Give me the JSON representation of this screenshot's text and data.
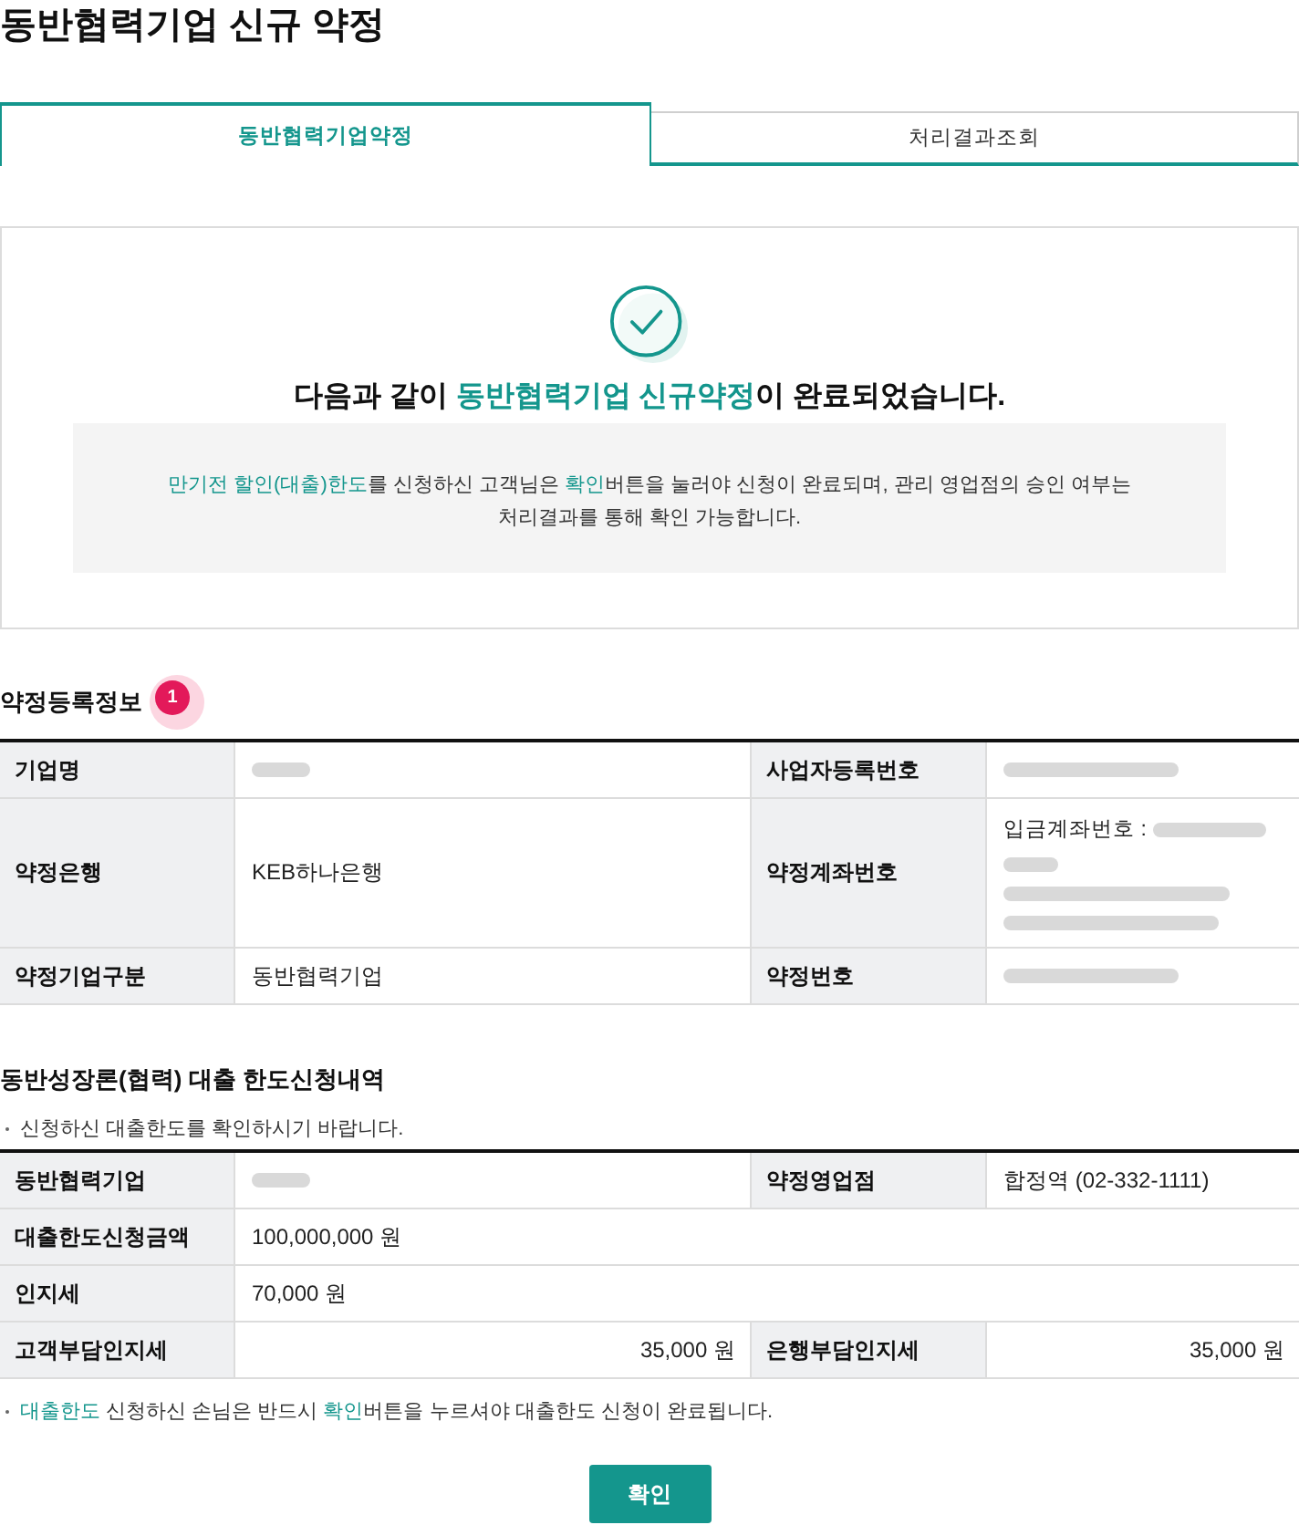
{
  "page": {
    "title": "동반협력기업 신규 약정"
  },
  "tabs": [
    {
      "label": "동반협력기업약정",
      "selected": true
    },
    {
      "label": "처리결과조회",
      "selected": false
    }
  ],
  "result": {
    "headline": "다음과 같이 **동반협력기업 신규약정**이 완료되었습니다.",
    "note": "**만기전 할인(대출)한도**를 신청하신 고객님은 **확인**버튼을 눌러야 신청이 완료되며, 관리 영업점의 승인 여부는 처리결과를 통해 확인 가능합니다."
  },
  "agreement": {
    "title": "약정등록정보",
    "badge": "1",
    "rows": [
      {
        "cells": [
          {
            "kind": "label",
            "text": "기업명"
          },
          {
            "kind": "redacted"
          },
          {
            "kind": "label",
            "text": "사업자등록번호"
          },
          {
            "kind": "redacted"
          }
        ]
      },
      {
        "cells": [
          {
            "kind": "label",
            "text": "약정은행"
          },
          {
            "kind": "value",
            "text": "KEB하나은행"
          },
          {
            "kind": "label",
            "text": "약정계좌번호"
          },
          {
            "kind": "account",
            "text": "입금계좌번호 :"
          }
        ]
      },
      {
        "cells": [
          {
            "kind": "label",
            "text": "약정기업구분"
          },
          {
            "kind": "value",
            "text": "동반협력기업"
          },
          {
            "kind": "label",
            "text": "약정번호"
          },
          {
            "kind": "redacted"
          }
        ]
      }
    ]
  },
  "loan": {
    "title": "동반성장론(협력) 대출 한도신청내역",
    "note": "신청하신 대출한도를 확인하시기 바랍니다.",
    "rows": [
      {
        "cells": [
          {
            "kind": "label",
            "text": "동반협력기업"
          },
          {
            "kind": "redacted"
          },
          {
            "kind": "label",
            "text": "약정영업점"
          },
          {
            "kind": "value",
            "text": "합정역 (02-332-1111)"
          }
        ]
      },
      {
        "cells": [
          {
            "kind": "label",
            "text": "대출한도신청금액"
          },
          {
            "kind": "value",
            "text": "100,000,000 원"
          }
        ]
      },
      {
        "cells": [
          {
            "kind": "label",
            "text": "인지세"
          },
          {
            "kind": "value",
            "text": "70,000 원"
          }
        ]
      },
      {
        "cells": [
          {
            "kind": "label",
            "text": "고객부담인지세"
          },
          {
            "kind": "amount",
            "text": "35,000 원"
          },
          {
            "kind": "label",
            "text": "은행부담인지세"
          },
          {
            "kind": "amount",
            "text": "35,000 원"
          }
        ]
      }
    ]
  },
  "footer": {
    "note": "**대출한도** 신청하신 손님은 반드시 **확인**버튼을 누르셔야 대출한도 신청이 완료됩니다.",
    "button": "확인"
  }
}
